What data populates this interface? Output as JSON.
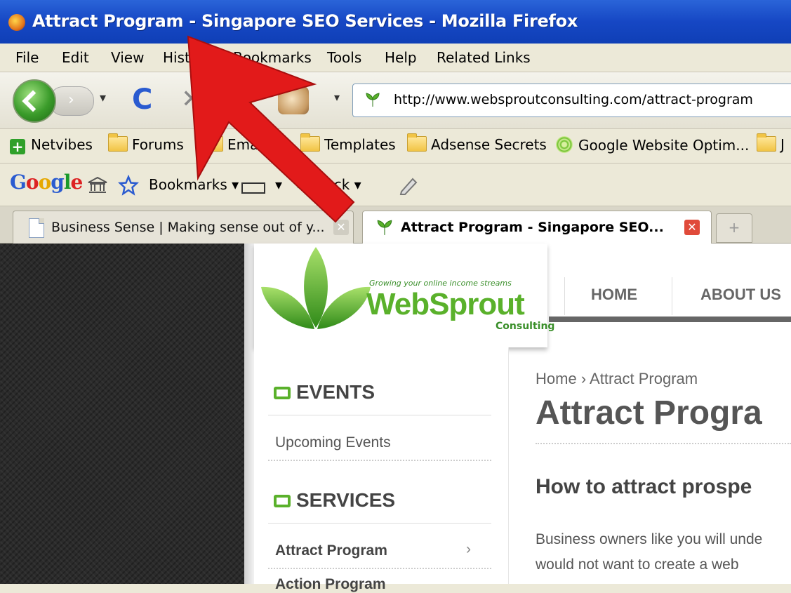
{
  "window": {
    "title": "Attract Program - Singapore SEO Services - Mozilla Firefox"
  },
  "menu": {
    "items": [
      "File",
      "Edit",
      "View",
      "History",
      "Bookmarks",
      "Tools",
      "Help",
      "Related Links"
    ]
  },
  "toolbar": {
    "url": "http://www.websproutconsulting.com/attract-program",
    "reload_glyph": "C",
    "stop_glyph": "✕",
    "dropdown_glyph": "▾"
  },
  "bookmarks_toolbar": {
    "items": [
      "Netvibes",
      "Forums",
      "Emails",
      "Templates",
      "Adsense Secrets",
      "Google Website Optim...",
      "J"
    ]
  },
  "google_toolbar": {
    "logo": "Google",
    "bookmarks_label": "Bookmarks",
    "check_label": "Check"
  },
  "tabs": [
    {
      "label": "Business Sense | Making sense out of y...",
      "active": false
    },
    {
      "label": "Attract Program - Singapore SEO...",
      "active": true
    }
  ],
  "newtab_glyph": "+",
  "site": {
    "logo_tagline": "Growing your online income streams",
    "logo_word": "WebSprout",
    "logo_sub": "Consulting",
    "nav": [
      "HOME",
      "ABOUT US"
    ],
    "sidebar": {
      "events_heading": "EVENTS",
      "events_links": [
        "Upcoming Events"
      ],
      "services_heading": "SERVICES",
      "services_links": [
        "Attract Program",
        "Action Program"
      ],
      "chevron": "›"
    },
    "breadcrumb": {
      "home": "Home",
      "sep": "›",
      "current": "Attract Program"
    },
    "page_title": "Attract Progra",
    "subheading": "How to attract prospe",
    "paragraph": [
      "Business owners like you will unde",
      "would not want to create a web"
    ]
  },
  "colors": {
    "brand_green": "#5ab12b",
    "annotation_arrow": "#e21a1a",
    "titlebar_blue": "#1647c4"
  }
}
